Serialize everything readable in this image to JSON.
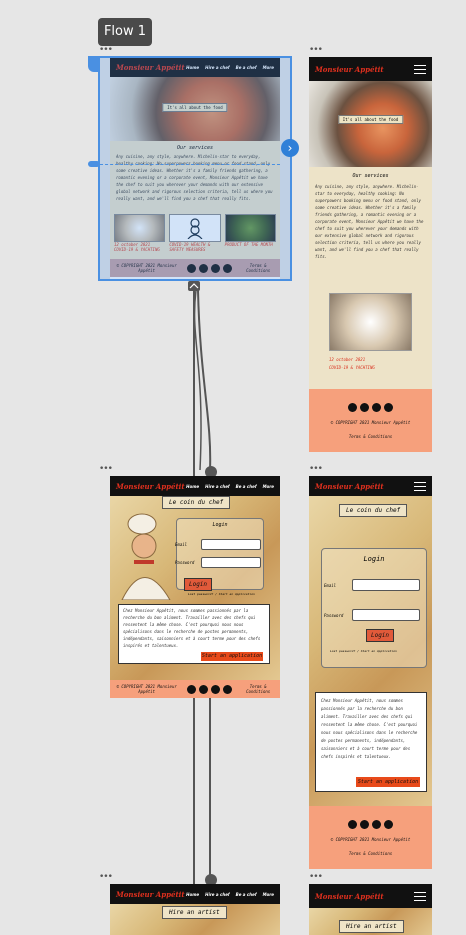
{
  "flow_label": "Flow 1",
  "brand": "Monsieur Appétit",
  "nav": [
    "Home",
    "Hire a chef",
    "Be a chef",
    "More"
  ],
  "hero_label": "It's all about the food",
  "services_title": "Our services",
  "services_text": "Any cuisine, any style, anywhere. Michelin-star to everyday, healthy cooking: No superpowers booking menu or food stand, only some creative ideas. Whether it's a family friends gathering, a romantic evening or a corporate event, Monsieur Appétit we have the chef to suit you wherever your demands with our extensive global network and rigorous selection criteria, tell us where you really want, and we'll find you a chef that really fits.",
  "cards": [
    {
      "date": "12 october 2021",
      "caption": "COVID-19 & YACHTING"
    },
    {
      "date": "",
      "caption": "COVID-19 HEALTH & SAFETY MEASURES"
    },
    {
      "date": "",
      "caption": "PRODUCT OF THE MONTH"
    }
  ],
  "footer_copy": "© COPYRIGHT 2021  Monsieur Appétit",
  "footer_terms": "Terms & Conditions",
  "chef_page_title": "Le coin du chef",
  "login_title": "Login",
  "email_label": "Email",
  "password_label": "Password",
  "login_button": "Login",
  "forgot_text": "Lost password? / Start an Application",
  "chef_card_text": "Chez Monsieur Appétit, nous sommes passionnés par la recherche du bon aliment. Travailler avec des chefs qui ressentent la même chose. C'est pourquoi nous nous spécialisons dans le recherche de postes permanents, indépendants, saisonniers et à court terme pour des chefs inspirés et talentueux.",
  "apply_button": "Start an application",
  "hire_title": "Hire an artist",
  "colors": {
    "accent": "#e0301e",
    "salmon": "#f6a07c",
    "beige": "#ede3c8",
    "selection": "#4a90e2"
  }
}
